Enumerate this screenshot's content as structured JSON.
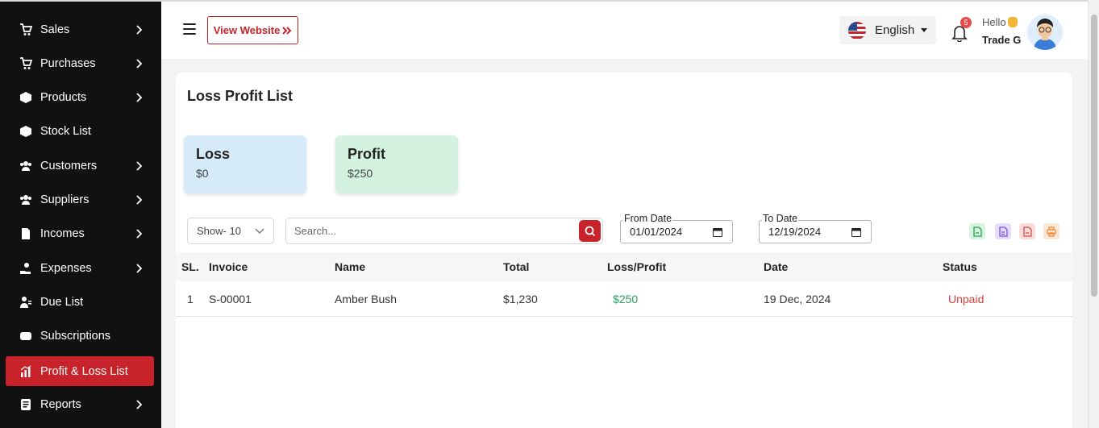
{
  "sidebar": {
    "items": [
      {
        "label": "Sales",
        "icon": "cart-icon",
        "has_submenu": true
      },
      {
        "label": "Purchases",
        "icon": "cart-icon",
        "has_submenu": true
      },
      {
        "label": "Products",
        "icon": "box-icon",
        "has_submenu": true
      },
      {
        "label": "Stock List",
        "icon": "box-icon",
        "has_submenu": false
      },
      {
        "label": "Customers",
        "icon": "users-icon",
        "has_submenu": true
      },
      {
        "label": "Suppliers",
        "icon": "users-icon",
        "has_submenu": true
      },
      {
        "label": "Incomes",
        "icon": "file-dollar-icon",
        "has_submenu": true
      },
      {
        "label": "Expenses",
        "icon": "hand-dollar-icon",
        "has_submenu": true
      },
      {
        "label": "Due List",
        "icon": "user-list-icon",
        "has_submenu": false
      },
      {
        "label": "Subscriptions",
        "icon": "ticket-icon",
        "has_submenu": false
      },
      {
        "label": "Profit & Loss List",
        "icon": "bar-chart-icon",
        "has_submenu": false,
        "active": true
      },
      {
        "label": "Reports",
        "icon": "report-icon",
        "has_submenu": true
      }
    ]
  },
  "header": {
    "view_website_label": "View Website",
    "language": "English",
    "notifications_count": "5",
    "greeting": "Hello",
    "user_name": "Trade G"
  },
  "main": {
    "title": "Loss Profit List",
    "cards": {
      "loss": {
        "title": "Loss",
        "value": "$0"
      },
      "profit": {
        "title": "Profit",
        "value": "$250"
      }
    },
    "filters": {
      "show_value": "Show- 10",
      "search_placeholder": "Search...",
      "from_label": "From Date",
      "from_value": "01/01/2024",
      "to_label": "To Date",
      "to_value": "12/19/2024"
    },
    "table": {
      "columns": [
        "SL.",
        "Invoice",
        "Name",
        "Total",
        "Loss/Profit",
        "Date",
        "Status"
      ],
      "rows": [
        [
          "1",
          "S-00001",
          "Amber Bush",
          "$1,230",
          "$250",
          "19 Dec, 2024",
          "Unpaid"
        ]
      ]
    }
  },
  "colors": {
    "accent": "#c8222b",
    "sidebar_bg": "#111111",
    "loss_card": "#d5ebfa",
    "profit_card": "#d3f3e0",
    "profit_text": "#27a35a",
    "unpaid_text": "#d94040"
  }
}
